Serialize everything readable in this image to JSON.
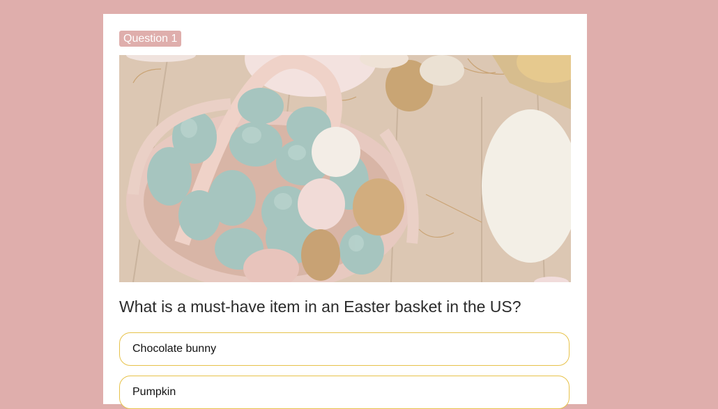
{
  "badge": {
    "label": "Question 1",
    "color": "#dfaeac"
  },
  "image": {
    "subject": "easter-eggs-in-basket-photo"
  },
  "question": {
    "text": "What is a must-have item in an Easter basket in the US?"
  },
  "options": [
    {
      "label": "Chocolate bunny"
    },
    {
      "label": "Pumpkin"
    }
  ],
  "colors": {
    "page_background": "#dfaeac",
    "card_background": "#ffffff",
    "option_border": "#e7c24a"
  }
}
